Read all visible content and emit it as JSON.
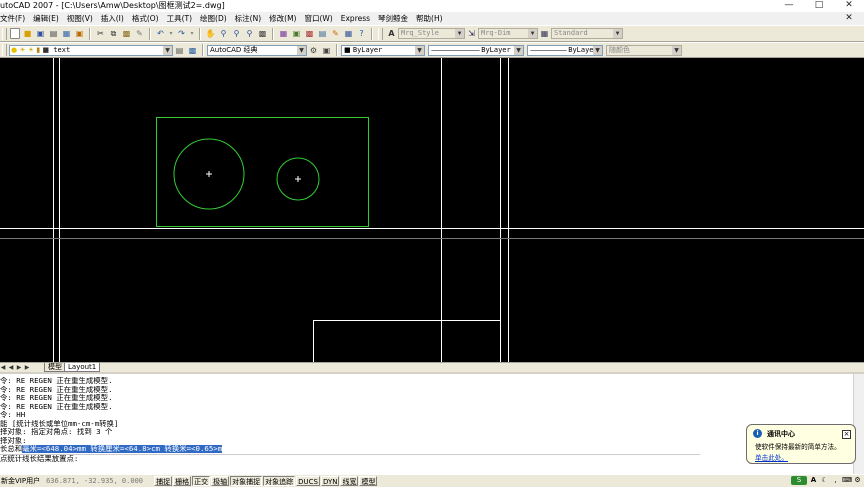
{
  "window": {
    "title": "utoCAD 2007 - [C:\\Users\\Amw\\Desktop\\图框测试2=.dwg]"
  },
  "menu": [
    "文件(F)",
    "编辑(E)",
    "视图(V)",
    "插入(I)",
    "格式(O)",
    "工具(T)",
    "绘图(D)",
    "标注(N)",
    "修改(M)",
    "窗口(W)",
    "Express",
    "琴剑鲸金",
    "帮助(H)"
  ],
  "toolbar": {
    "text_style": "Mrq_Style",
    "dim_style": "Mrq-Dim",
    "table_style": "Standard",
    "layer": "text",
    "workspace": "AutoCAD 经典",
    "color": "ByLayer",
    "linetype": "ByLayer",
    "lineweight": "ByLayer",
    "plot_style": "随颜色"
  },
  "tabs": [
    "模型",
    "Layout1"
  ],
  "command": {
    "lines": [
      "令: RE REGEN 正在重生成模型.",
      "令: RE REGEN 正在重生成模型.",
      "令: RE REGEN 正在重生成模型.",
      "令: RE REGEN 正在重生成模型.",
      "令: HH",
      "能 [统计线长或单位mm-cm-m转换]",
      "择对象: 指定对角点: 找到 3 个",
      "择对象:"
    ],
    "result_prefix": "长总和",
    "result_highlight": "毫米=<648.04>mm  转换厘米=<64.8>cm  转换米=<0.65>m",
    "prompt": "点统计线长结果放置点:"
  },
  "notification": {
    "title": "通讯中心",
    "body": "使软件保持最新的简单方法。",
    "link": "单击此处。"
  },
  "status": {
    "user": "新金VIP用户",
    "coords": "636.871, -32.935, 0.000",
    "buttons": [
      "捕捉",
      "栅格",
      "正交",
      "极轴",
      "对象捕捉",
      "对象追踪",
      "DUCS",
      "DYN",
      "线宽",
      "模型"
    ]
  },
  "colors": {
    "canvas_bg": "#000000",
    "geometry": "#33cc33",
    "frame_lines": "#ffffff",
    "highlight": "#316ac5"
  },
  "icons": {
    "tb1": [
      "new-icon",
      "open-icon",
      "save-icon",
      "print-icon",
      "preview-icon",
      "publish-icon",
      "cut-icon",
      "copy-icon",
      "paste-icon",
      "match-icon",
      "undo-icon",
      "redo-icon",
      "pan-icon",
      "zoom-realtime-icon",
      "zoom-window-icon",
      "zoom-previous-icon",
      "properties-icon",
      "designcenter-icon",
      "toolpalette-icon",
      "sheetset-icon",
      "markup-icon",
      "calculator-icon",
      "help-icon"
    ],
    "tb2": [
      "layer-manager-icon",
      "layer-prev-icon",
      "make-current-icon",
      "workspace-settings-icon"
    ]
  }
}
